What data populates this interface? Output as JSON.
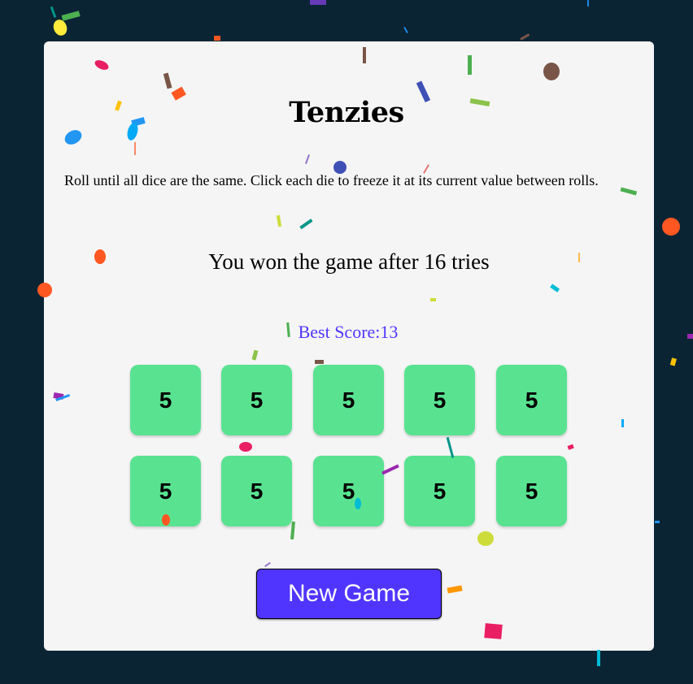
{
  "game": {
    "title": "Tenzies",
    "instructions": "Roll until all dice are the same. Click each die to freeze it at its current value between rolls.",
    "status": "You won the game after 16 tries",
    "best_score": "Best Score:13",
    "dice": [
      "5",
      "5",
      "5",
      "5",
      "5",
      "5",
      "5",
      "5",
      "5",
      "5"
    ],
    "new_game_label": "New Game"
  },
  "colors": {
    "background": "#0b2434",
    "card": "#f5f5f5",
    "die": "#59e391",
    "accent": "#5035ff"
  }
}
